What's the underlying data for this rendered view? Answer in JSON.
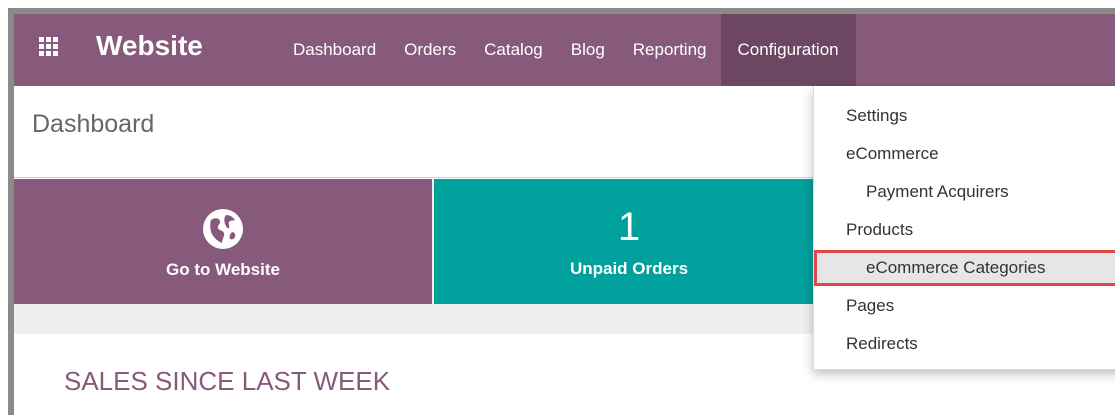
{
  "navbar": {
    "app_title": "Website",
    "menu": [
      "Dashboard",
      "Orders",
      "Catalog",
      "Blog",
      "Reporting",
      "Configuration"
    ],
    "active": "Configuration",
    "color": "#875a7b",
    "active_color": "#6c4662"
  },
  "breadcrumb": {
    "title": "Dashboard"
  },
  "tiles": {
    "website": {
      "label": "Go to Website",
      "icon": "globe-icon",
      "color": "#875a7b"
    },
    "orders": {
      "count": "1",
      "label": "Unpaid Orders",
      "color": "#00a09d"
    }
  },
  "sales": {
    "title": "SALES SINCE LAST WEEK"
  },
  "dropdown": {
    "items": [
      {
        "label": "Settings",
        "kind": "link"
      },
      {
        "label": "eCommerce",
        "kind": "header"
      },
      {
        "label": "Payment Acquirers",
        "kind": "sub"
      },
      {
        "label": "Products",
        "kind": "header"
      },
      {
        "label": "eCommerce Categories",
        "kind": "sub",
        "highlighted": true
      },
      {
        "label": "Pages",
        "kind": "link"
      },
      {
        "label": "Redirects",
        "kind": "link"
      }
    ],
    "highlight_color": "#e04848"
  }
}
